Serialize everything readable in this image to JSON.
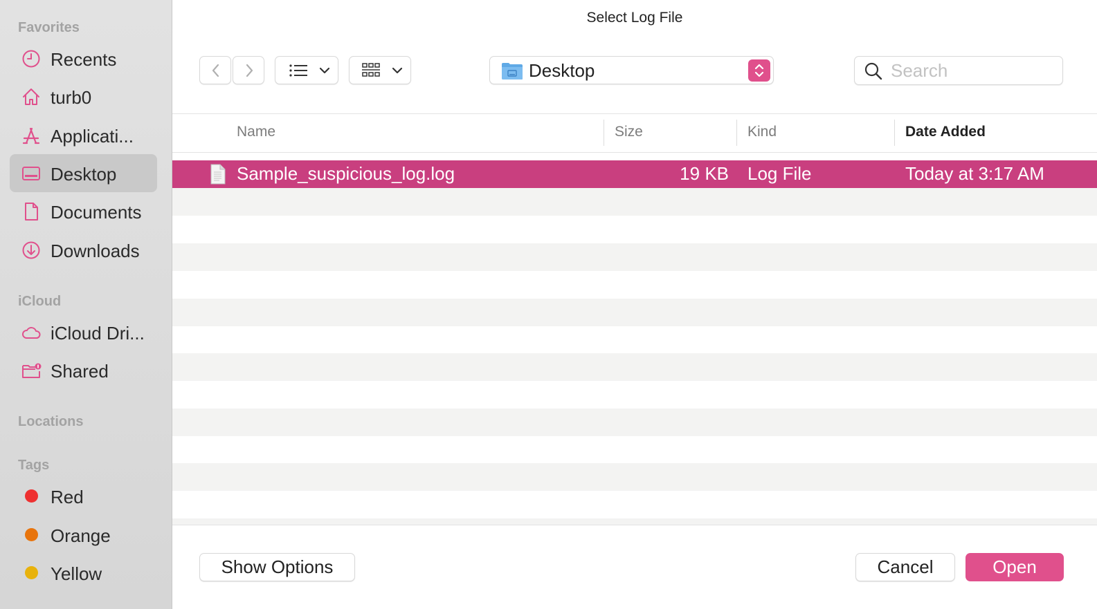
{
  "dialog": {
    "title": "Select Log File"
  },
  "sidebar": {
    "sections": {
      "favorites": "Favorites",
      "icloud": "iCloud",
      "locations": "Locations",
      "tags": "Tags"
    },
    "favorites": [
      {
        "label": "Recents",
        "icon": "clock-icon"
      },
      {
        "label": "turb0",
        "icon": "home-icon"
      },
      {
        "label": "Applicati...",
        "icon": "applications-icon"
      },
      {
        "label": "Desktop",
        "icon": "desktop-icon",
        "selected": true
      },
      {
        "label": "Documents",
        "icon": "document-icon"
      },
      {
        "label": "Downloads",
        "icon": "download-icon"
      }
    ],
    "icloud": [
      {
        "label": "iCloud Dri...",
        "icon": "cloud-icon"
      },
      {
        "label": "Shared",
        "icon": "shared-folder-icon"
      }
    ],
    "tags": [
      {
        "label": "Red",
        "color": "#ee3030"
      },
      {
        "label": "Orange",
        "color": "#e8740c"
      },
      {
        "label": "Yellow",
        "color": "#e8b20c"
      }
    ]
  },
  "toolbar": {
    "path": "Desktop",
    "search_placeholder": "Search",
    "search_value": ""
  },
  "table": {
    "columns": {
      "name": "Name",
      "size": "Size",
      "kind": "Kind",
      "date_added": "Date Added"
    },
    "sorted_column": "date_added",
    "rows": [
      {
        "name": "Sample_suspicious_log.log",
        "size": "19 KB",
        "kind": "Log File",
        "date_added": "Today at 3:17 AM",
        "selected": true
      }
    ]
  },
  "buttons": {
    "show_options": "Show Options",
    "cancel": "Cancel",
    "open": "Open"
  },
  "colors": {
    "accent": "#e0508c",
    "selection": "#c93f7f",
    "icon_pink": "#e0508c"
  }
}
